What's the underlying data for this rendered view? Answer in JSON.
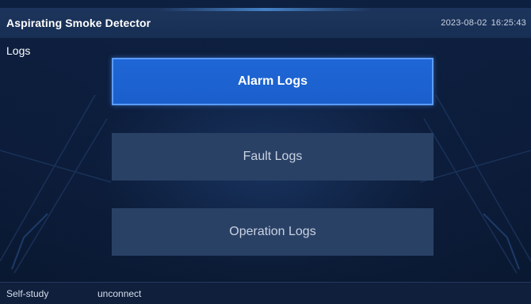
{
  "header": {
    "title": "Aspirating Smoke Detector",
    "date": "2023-08-02",
    "time": "16:25:43"
  },
  "page": {
    "title": "Logs"
  },
  "menu": {
    "items": [
      {
        "label": "Alarm Logs",
        "selected": true
      },
      {
        "label": "Fault Logs",
        "selected": false
      },
      {
        "label": "Operation Logs",
        "selected": false
      }
    ]
  },
  "status": {
    "mode": "Self-study",
    "connection": "unconnect"
  },
  "colors": {
    "background": "#0c1c3a",
    "topbar": "#1a3157",
    "selected_button": "#1a5fcc",
    "selected_border": "#5b9cff",
    "button": "#2a4166",
    "text": "#ffffff"
  }
}
